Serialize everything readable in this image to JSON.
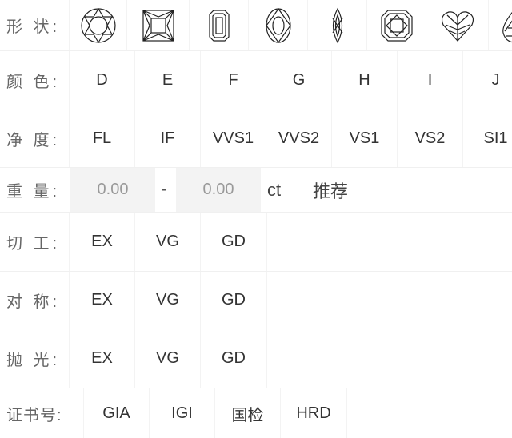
{
  "shape": {
    "label": "形 状:",
    "options": [
      {
        "name": "round",
        "icon": "round-diamond-icon"
      },
      {
        "name": "princess",
        "icon": "princess-diamond-icon"
      },
      {
        "name": "emerald",
        "icon": "emerald-diamond-icon"
      },
      {
        "name": "oval",
        "icon": "oval-diamond-icon"
      },
      {
        "name": "marquise",
        "icon": "marquise-diamond-icon"
      },
      {
        "name": "cushion",
        "icon": "cushion-diamond-icon"
      },
      {
        "name": "heart",
        "icon": "heart-diamond-icon"
      },
      {
        "name": "pear",
        "icon": "pear-diamond-icon"
      }
    ]
  },
  "color": {
    "label": "颜 色:",
    "options": [
      "D",
      "E",
      "F",
      "G",
      "H",
      "I",
      "J"
    ]
  },
  "clarity": {
    "label": "净 度:",
    "options": [
      "FL",
      "IF",
      "VVS1",
      "VVS2",
      "VS1",
      "VS2",
      "SI1"
    ]
  },
  "weight": {
    "label": "重 量:",
    "min_placeholder": "0.00",
    "separator": "-",
    "max_placeholder": "0.00",
    "unit": "ct",
    "recommend": "推荐"
  },
  "cut": {
    "label": "切 工:",
    "options": [
      "EX",
      "VG",
      "GD"
    ]
  },
  "symmetry": {
    "label": "对 称:",
    "options": [
      "EX",
      "VG",
      "GD"
    ]
  },
  "polish": {
    "label": "抛 光:",
    "options": [
      "EX",
      "VG",
      "GD"
    ]
  },
  "certificate": {
    "label": "证书号:",
    "options": [
      "GIA",
      "IGI",
      "国检",
      "HRD"
    ]
  }
}
